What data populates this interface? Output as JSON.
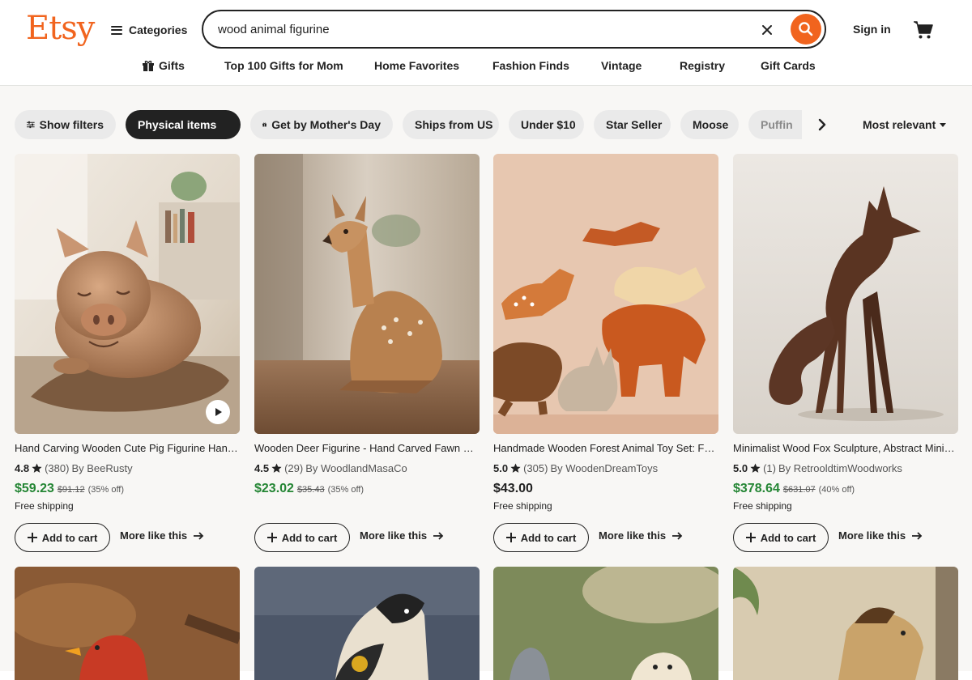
{
  "header": {
    "logo": "Etsy",
    "categories_label": "Categories",
    "search_value": "wood animal figurine",
    "signin_label": "Sign in"
  },
  "nav": {
    "items": [
      "Gifts",
      "Top 100 Gifts for Mom",
      "Home Favorites",
      "Fashion Finds",
      "Vintage",
      "Registry",
      "Gift Cards"
    ]
  },
  "filters": {
    "show_filters": "Show filters",
    "active": "Physical items",
    "chips": [
      "Get by Mother's Day",
      "Ships from US",
      "Under $10",
      "Star Seller",
      "Moose",
      "Puffin"
    ],
    "sort": "Most relevant"
  },
  "listings": [
    {
      "title": "Hand Carving Wooden Cute Pig Figurine Handmade",
      "score": "4.8",
      "reviews": "(380)",
      "shop": "By BeeRusty",
      "price": "$59.23",
      "original": "$91.12",
      "discount": "(35% off)",
      "shipping": "Free shipping",
      "has_video": true
    },
    {
      "title": "Wooden Deer Figurine - Hand Carved Fawn Statue",
      "score": "4.5",
      "reviews": "(29)",
      "shop": "By WoodlandMasaCo",
      "price": "$23.02",
      "original": "$35.43",
      "discount": "(35% off)",
      "shipping": ""
    },
    {
      "title": "Handmade Wooden Forest Animal Toy Set: Fox, Moose",
      "score": "5.0",
      "reviews": "(305)",
      "shop": "By WoodenDreamToys",
      "price": "$43.00",
      "original": "",
      "discount": "",
      "shipping": "Free shipping"
    },
    {
      "title": "Minimalist Wood Fox Sculpture, Abstract Minimal Art",
      "score": "5.0",
      "reviews": "(1)",
      "shop": "By RetrooldtimWoodworks",
      "price": "$378.64",
      "original": "$631.07",
      "discount": "(40% off)",
      "shipping": "Free shipping"
    }
  ],
  "card_actions": {
    "add_to_cart": "Add to cart",
    "more_like_this": "More like this"
  },
  "colors": {
    "brand": "#f1641e",
    "sale_price": "#258635",
    "chip_bg": "#eaeaea",
    "active_chip": "#222222"
  },
  "icons": {
    "search": "search-icon",
    "clear": "close-icon",
    "cart": "cart-icon",
    "gift": "gift-icon",
    "star": "star-icon",
    "play": "play-icon",
    "plus": "plus-icon",
    "arrow": "arrow-right-icon"
  }
}
